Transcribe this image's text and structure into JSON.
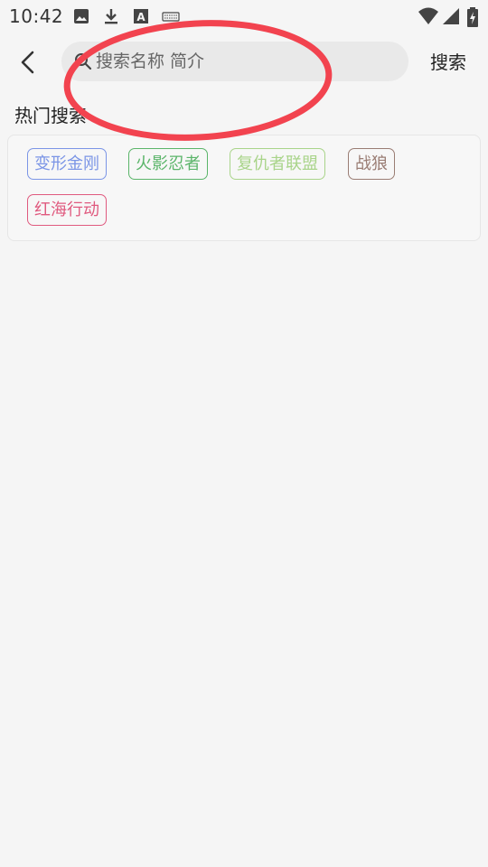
{
  "status_bar": {
    "time": "10:42",
    "left_icons": [
      "image-icon",
      "download-icon",
      "font-a-icon",
      "keyboard-icon"
    ],
    "right_icons": [
      "wifi-icon",
      "signal-icon",
      "battery-charging-icon"
    ]
  },
  "header": {
    "back_icon": "chevron-left-icon",
    "search_placeholder": "搜索名称 简介",
    "search_value": "",
    "search_button_label": "搜索"
  },
  "hot_search": {
    "title": "热门搜索",
    "tags": [
      {
        "label": "变形金刚",
        "color": "#7b95e6"
      },
      {
        "label": "火影忍者",
        "color": "#5bb56a"
      },
      {
        "label": "复仇者联盟",
        "color": "#a9d48a"
      },
      {
        "label": "战狼",
        "color": "#9a7d74"
      },
      {
        "label": "红海行动",
        "color": "#e05a7f"
      }
    ]
  },
  "annotation": {
    "shape": "ellipse",
    "color": "#f2434f"
  },
  "colors": {
    "background": "#f5f5f5",
    "search_bg": "#e9e9e9"
  }
}
